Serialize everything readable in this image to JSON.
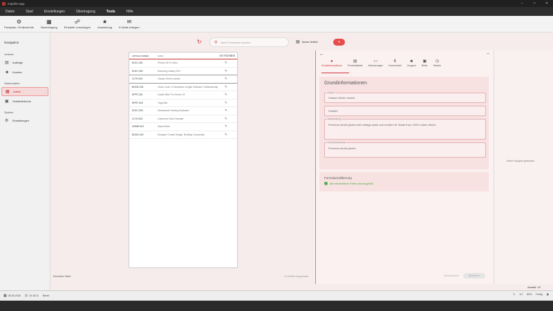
{
  "window": {
    "title": "mapline.app"
  },
  "menu": [
    "Daten",
    "Start",
    "Einstellungen",
    "Übertragung",
    "Tools",
    "Hilfe"
  ],
  "ribbon": [
    {
      "label": "Packplatz / Endkontrolle",
      "icon": "gear-icon"
    },
    {
      "label": "Warenfegang",
      "icon": "box-icon"
    },
    {
      "label": "Einkäufe vorschlagen",
      "icon": "cart-icon"
    },
    {
      "label": "Auswertung",
      "icon": "chart-icon"
    },
    {
      "label": "E-Mails einlegen",
      "icon": "mail-icon"
    }
  ],
  "sidebar": {
    "title": "Navigation",
    "sections": [
      {
        "label": "Vertrieb",
        "items": [
          {
            "label": "Aufträge",
            "icon": "clipboard-icon"
          },
          {
            "label": "Kunden",
            "icon": "users-icon"
          }
        ]
      },
      {
        "label": "Stammdaten",
        "items": [
          {
            "label": "Artikel",
            "icon": "box-icon",
            "active": true
          },
          {
            "label": "Verkäuferkonto",
            "icon": "account-icon"
          }
        ]
      },
      {
        "label": "System",
        "items": [
          {
            "label": "Einstellungen",
            "icon": "gear-icon"
          }
        ]
      }
    ]
  },
  "search": {
    "placeholder": "Nach Produkten suchen..."
  },
  "toolbar": {
    "new_label": "Neuer Artikel",
    "delete_label": "x"
  },
  "product_table": {
    "headers": [
      "ARTIKELNUMMER",
      "NAME",
      "AKTIONEN"
    ],
    "rows": [
      {
        "sku": "ELEC-001",
        "name": "iPhone 15 Pro Max",
        "group_end": false
      },
      {
        "sku": "ELEC-002",
        "name": "Samsung Galaxy S24",
        "group_end": true
      },
      {
        "sku": "CLTH-001",
        "name": "Classic Denim Jacket",
        "group_end": true
      },
      {
        "sku": "BOOK-001",
        "name": "Clean Code: A Handbook of Agile Software Craftsmanship",
        "group_end": false
      },
      {
        "sku": "SPRT-001",
        "name": "Cardio Bike Pro Series X3",
        "group_end": false
      },
      {
        "sku": "SPRT-003",
        "name": "Yoga Mat",
        "group_end": false
      },
      {
        "sku": "ELEC-003",
        "name": "Mechanical Gaming Keyboard",
        "group_end": false
      },
      {
        "sku": "CLTH-002",
        "name": "Cashmere Wool Sweater",
        "group_end": false
      },
      {
        "sku": "HOME-002",
        "name": "Stand Mixer",
        "group_end": false
      },
      {
        "sku": "BOOK-002",
        "name": "Designer Create Design: Building Complexity",
        "group_end": false
      }
    ]
  },
  "list_footer": {
    "left": "Einzelne Seite",
    "right": "11 Artikel insgesamt"
  },
  "detail": {
    "tabs": [
      {
        "label": "Grundinformationen",
        "icon": "info-icon",
        "active": true
      },
      {
        "label": "Produktdetails",
        "icon": "document-icon"
      },
      {
        "label": "Abmessungen",
        "icon": "ruler-icon"
      },
      {
        "label": "Kommerziell",
        "icon": "euro-icon"
      },
      {
        "label": "Gruppen",
        "icon": "group-icon"
      },
      {
        "label": "Bilder",
        "icon": "image-icon"
      },
      {
        "label": "Historie",
        "icon": "history-icon"
      }
    ],
    "section_title": "Grundinformationen",
    "fields": {
      "name": {
        "label": "Name *",
        "value": "Classic Denim Jacket"
      },
      "subtitle": {
        "label": "",
        "value": "Subtitel"
      },
      "description": {
        "label": "Beschreibung",
        "value": "Premium denim jacket with vintage wash and modern fit. Made from 100% cotton denim"
      },
      "short_description": {
        "label": "Kurzbeschreibung",
        "value": "Premium denim jacket"
      }
    },
    "validation": {
      "title": "Formularvalidierung",
      "message": "Alle erforderlichen Felder sind ausgefüllt"
    },
    "footer": {
      "discard": "Zurücksetzen",
      "save": "Speichern"
    }
  },
  "right_panel": {
    "text": "Keine Gruppen gefunden"
  },
  "count_label": "Anzahl: 10",
  "statusbar": {
    "date": "05.05.2026",
    "time": "10:18:11",
    "status": "Bereit",
    "page": "1/1",
    "zoom": "85%",
    "mode": "Fertig"
  }
}
